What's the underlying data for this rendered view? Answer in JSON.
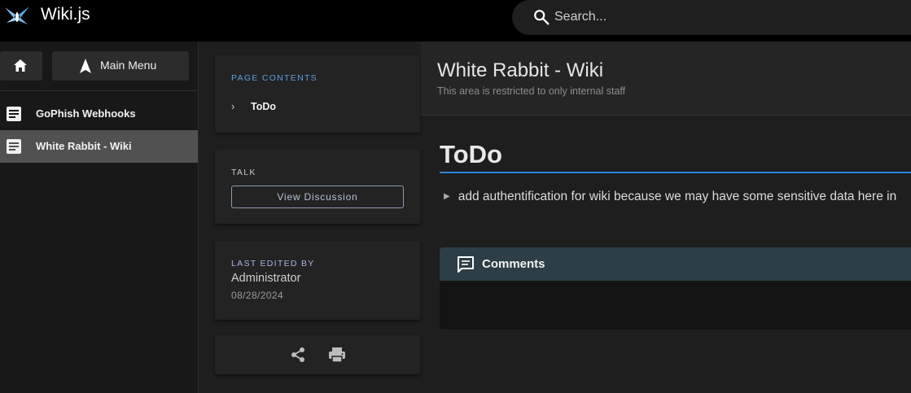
{
  "app": {
    "title": "Wiki.js"
  },
  "search": {
    "placeholder": "Search..."
  },
  "sidebar": {
    "main_menu_label": "Main Menu",
    "items": [
      {
        "label": "GoPhish Webhooks"
      },
      {
        "label": "White Rabbit - Wiki"
      }
    ]
  },
  "toc": {
    "heading": "PAGE CONTENTS",
    "items": [
      {
        "label": "ToDo"
      }
    ]
  },
  "talk": {
    "heading": "TALK",
    "button_label": "View Discussion"
  },
  "last_edited": {
    "heading": "LAST EDITED BY",
    "name": "Administrator",
    "date": "08/28/2024"
  },
  "page": {
    "title": "White Rabbit - Wiki",
    "subtitle": "This area is restricted to only internal staff"
  },
  "content": {
    "heading": "ToDo",
    "items": [
      "add authentification for wiki because we may have some sensitive data here in"
    ]
  },
  "comments": {
    "label": "Comments"
  },
  "icons": {
    "logo": "wikijs-logo-icon",
    "search": "search-icon",
    "home": "home-icon",
    "menu": "navigation-arrow-icon",
    "doc": "document-icon",
    "share": "share-icon",
    "print": "print-icon",
    "comment": "comment-icon"
  },
  "colors": {
    "accent": "#2f84d6",
    "toc_heading": "#5a9fe0",
    "talk_heading": "#c9c9c9",
    "edited_heading": "#a9b4e6",
    "comments_bar": "#2c3e47"
  }
}
